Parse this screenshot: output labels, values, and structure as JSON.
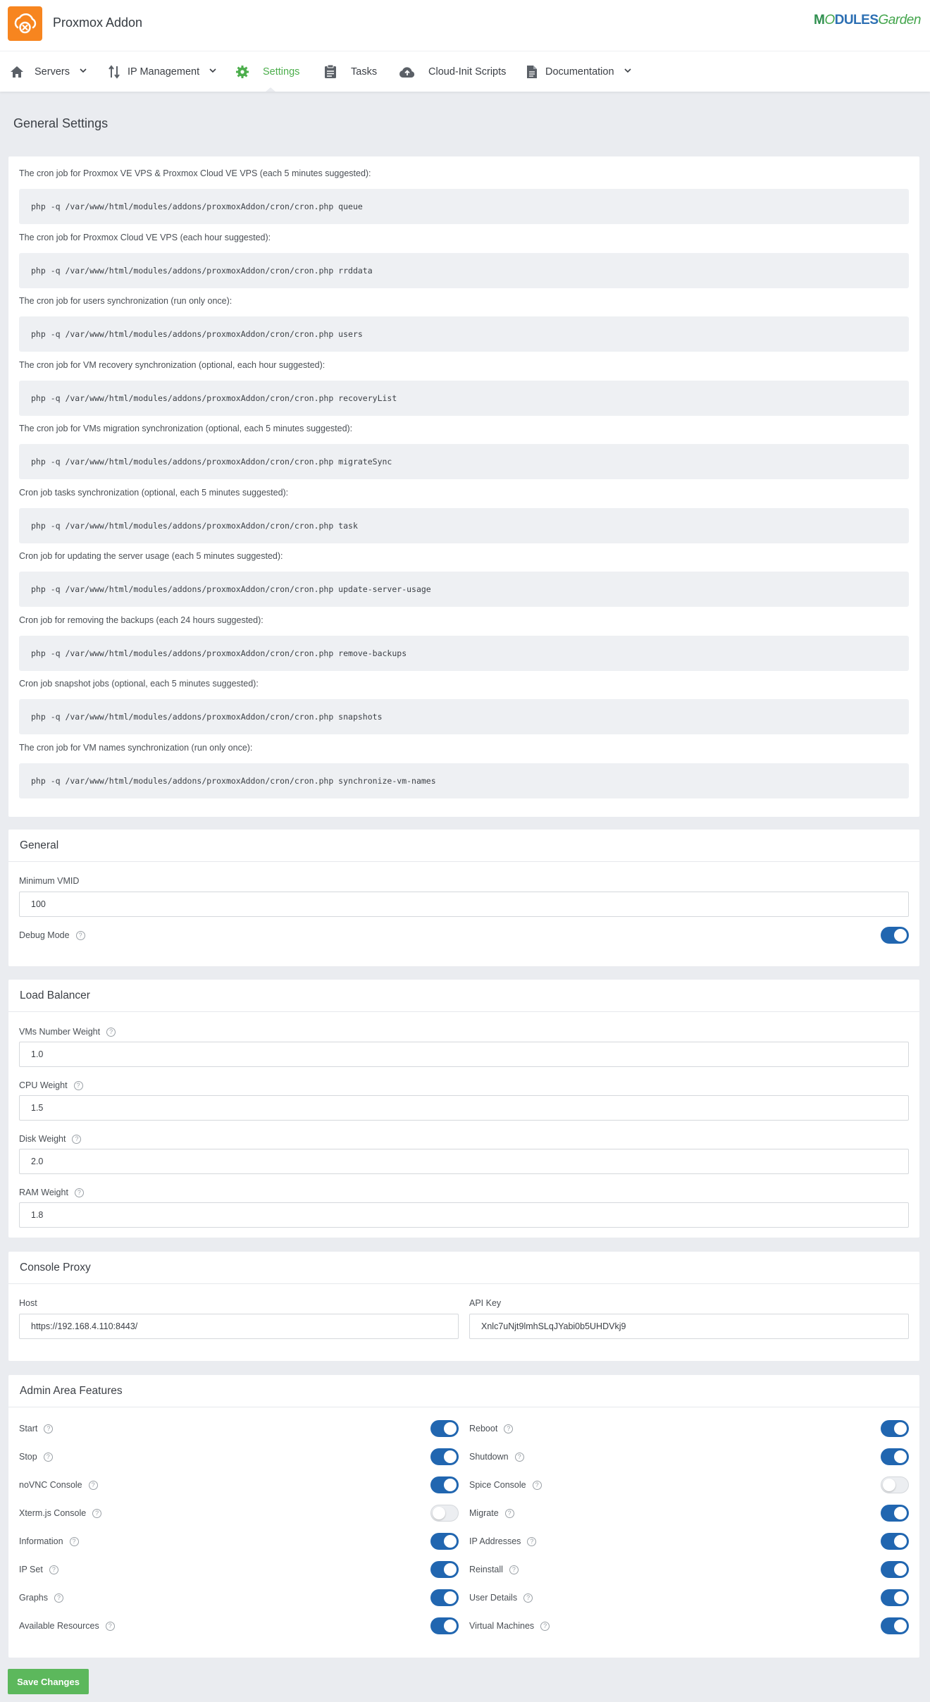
{
  "header": {
    "app_title": "Proxmox Addon",
    "brand_logo": {
      "part1": "M",
      "part2": "O",
      "part3": "DULES",
      "part4": "Garden"
    },
    "accent_color": "#f7851f"
  },
  "nav": {
    "items": [
      {
        "label": "Servers",
        "icon": "home-icon",
        "dropdown": true
      },
      {
        "label": "IP Management",
        "icon": "sort-arrows-icon",
        "dropdown": true
      },
      {
        "label": "Settings",
        "icon": "gear-icon",
        "dropdown": false,
        "active": true
      },
      {
        "label": "Tasks",
        "icon": "clipboard-icon",
        "dropdown": false
      },
      {
        "label": "Cloud-Init Scripts",
        "icon": "cloud-upload-icon",
        "dropdown": false
      },
      {
        "label": "Documentation",
        "icon": "document-icon",
        "dropdown": true
      }
    ],
    "active_color": "#4cae4c"
  },
  "page_title": "General Settings",
  "cron": [
    {
      "label": "The cron job for Proxmox VE VPS & Proxmox Cloud VE VPS (each 5 minutes suggested):",
      "command": "php -q /var/www/html/modules/addons/proxmoxAddon/cron/cron.php queue"
    },
    {
      "label": "The cron job for Proxmox Cloud VE VPS (each hour suggested):",
      "command": "php -q /var/www/html/modules/addons/proxmoxAddon/cron/cron.php rrddata"
    },
    {
      "label": "The cron job for users synchronization (run only once):",
      "command": "php -q /var/www/html/modules/addons/proxmoxAddon/cron/cron.php users"
    },
    {
      "label": "The cron job for VM recovery synchronization (optional, each hour suggested):",
      "command": "php -q /var/www/html/modules/addons/proxmoxAddon/cron/cron.php recoveryList"
    },
    {
      "label": "The cron job for VMs migration synchronization (optional, each 5 minutes suggested):",
      "command": "php -q /var/www/html/modules/addons/proxmoxAddon/cron/cron.php migrateSync"
    },
    {
      "label": "Cron job tasks synchronization (optional, each 5 minutes suggested):",
      "command": "php -q /var/www/html/modules/addons/proxmoxAddon/cron/cron.php task"
    },
    {
      "label": "Cron job for updating the server usage (each 5 minutes suggested):",
      "command": "php -q /var/www/html/modules/addons/proxmoxAddon/cron/cron.php update-server-usage"
    },
    {
      "label": "Cron job for removing the backups (each 24 hours suggested):",
      "command": "php -q /var/www/html/modules/addons/proxmoxAddon/cron/cron.php remove-backups"
    },
    {
      "label": "Cron job snapshot jobs (optional, each 5 minutes suggested):",
      "command": "php -q /var/www/html/modules/addons/proxmoxAddon/cron/cron.php snapshots"
    },
    {
      "label": "The cron job for VM names synchronization (run only once):",
      "command": "php -q /var/www/html/modules/addons/proxmoxAddon/cron/cron.php synchronize-vm-names"
    }
  ],
  "general": {
    "title": "General",
    "min_vmid_label": "Minimum VMID",
    "min_vmid_value": "100",
    "debug_label": "Debug Mode",
    "debug_on": true
  },
  "load_balancer": {
    "title": "Load Balancer",
    "fields": [
      {
        "label": "VMs Number Weight",
        "value": "1.0"
      },
      {
        "label": "CPU Weight",
        "value": "1.5"
      },
      {
        "label": "Disk Weight",
        "value": "2.0"
      },
      {
        "label": "RAM Weight",
        "value": "1.8"
      }
    ]
  },
  "console_proxy": {
    "title": "Console Proxy",
    "host_label": "Host",
    "host_value": "https://192.168.4.110:8443/",
    "api_key_label": "API Key",
    "api_key_value": "Xnlc7uNjt9lmhSLqJYabi0b5UHDVkj9"
  },
  "admin_features": {
    "title": "Admin Area Features",
    "left": [
      {
        "label": "Start",
        "on": true
      },
      {
        "label": "Stop",
        "on": true
      },
      {
        "label": "noVNC Console",
        "on": true
      },
      {
        "label": "Xterm.js Console",
        "on": false
      },
      {
        "label": "Information",
        "on": true
      },
      {
        "label": "IP Set",
        "on": true
      },
      {
        "label": "Graphs",
        "on": true
      },
      {
        "label": "Available Resources",
        "on": true
      }
    ],
    "right": [
      {
        "label": "Reboot",
        "on": true
      },
      {
        "label": "Shutdown",
        "on": true
      },
      {
        "label": "Spice Console",
        "on": false
      },
      {
        "label": "Migrate",
        "on": true
      },
      {
        "label": "IP Addresses",
        "on": true
      },
      {
        "label": "Reinstall",
        "on": true
      },
      {
        "label": "User Details",
        "on": true
      },
      {
        "label": "Virtual Machines",
        "on": true
      }
    ]
  },
  "save_button_label": "Save Changes",
  "save_button_color": "#5cb85c",
  "toggle_on_color": "#2166b0"
}
